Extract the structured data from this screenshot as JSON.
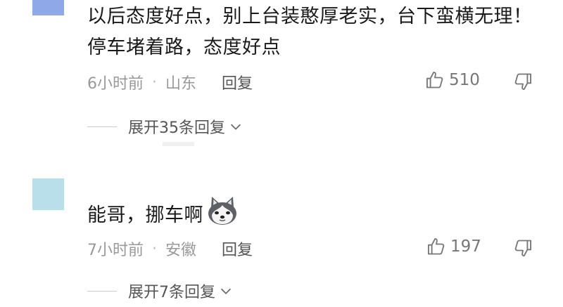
{
  "comments": [
    {
      "text": "以后态度好点，别上台装憨厚老实，台下蛮横无理！停车堵着路，态度好点",
      "time": "6小时前",
      "location": "山东",
      "reply_label": "回复",
      "likes": "510",
      "expand_label": "展开35条回复",
      "avatar_color": "#8fa8e8"
    },
    {
      "text": "能哥，挪车啊",
      "emoji": "husky-dog-emoji",
      "time": "7小时前",
      "location": "安徽",
      "reply_label": "回复",
      "likes": "197",
      "expand_label": "展开7条回复",
      "avatar_color": "#b9e0ea"
    }
  ],
  "separator": "·"
}
